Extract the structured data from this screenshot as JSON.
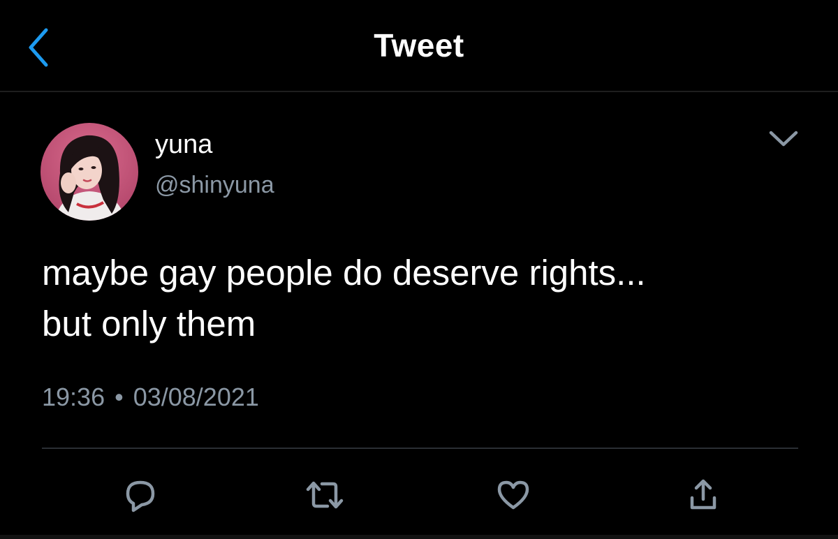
{
  "header": {
    "title": "Tweet",
    "back_icon": "chevron-left-icon"
  },
  "tweet": {
    "author": {
      "display_name": "yuna",
      "handle": "@shinyuna",
      "avatar": "profile-photo"
    },
    "more_icon": "chevron-down-icon",
    "text": "maybe gay people do deserve rights...\nbut only them",
    "time": "19:36",
    "separator": "•",
    "date": "03/08/2021"
  },
  "actions": [
    {
      "name": "reply",
      "icon": "reply-icon"
    },
    {
      "name": "retweet",
      "icon": "retweet-icon"
    },
    {
      "name": "like",
      "icon": "heart-icon"
    },
    {
      "name": "share",
      "icon": "share-icon"
    }
  ],
  "colors": {
    "background": "#000000",
    "text_primary": "#ffffff",
    "text_secondary": "#8b98a5",
    "accent": "#1d9bf0",
    "divider": "#2a2f34"
  }
}
